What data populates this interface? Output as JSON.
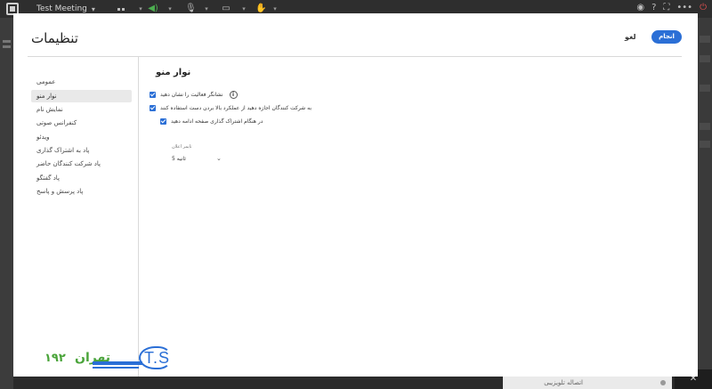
{
  "app": {
    "meeting_title": "Test Meeting"
  },
  "modal": {
    "title": "تنظیمات",
    "cancel_label": "لغو",
    "done_label": "انجام"
  },
  "sidebar": {
    "items": [
      {
        "label": "عمومی"
      },
      {
        "label": "نوار منو",
        "active": true
      },
      {
        "label": "نمایش نام"
      },
      {
        "label": "کنفرانس صوتی"
      },
      {
        "label": "ویدئو"
      },
      {
        "label": "پاد به اشتراک گذاری"
      },
      {
        "label": "پاد شرکت کنندگان حاضر"
      },
      {
        "label": "پاد گفتگو"
      },
      {
        "label": "پاد پرسش و پاسخ"
      }
    ]
  },
  "content": {
    "section_title": "نوار منو",
    "options": [
      {
        "label": "نشانگر فعالیت را نشان دهید",
        "checked": true,
        "info_icon": true
      },
      {
        "label": "به شرکت کنندگان اجازه دهید از عملکرد بالا بردن دست استفاده کنند",
        "checked": true
      },
      {
        "label": "در هنگام اشتراک گذاری صفحه ادامه دهید",
        "checked": true
      }
    ],
    "timer_label": "تایمر اعلان",
    "timer_value": "5 ثانیه"
  },
  "bottom": {
    "chip_text": "اتصاله تلویزیبی"
  },
  "watermark": {
    "ts_text": "T.S",
    "brand_text": "تهران",
    "number_text": "۱۹۲"
  },
  "colors": {
    "accent": "#2b6fd6",
    "brand_green": "#4aa43a"
  }
}
